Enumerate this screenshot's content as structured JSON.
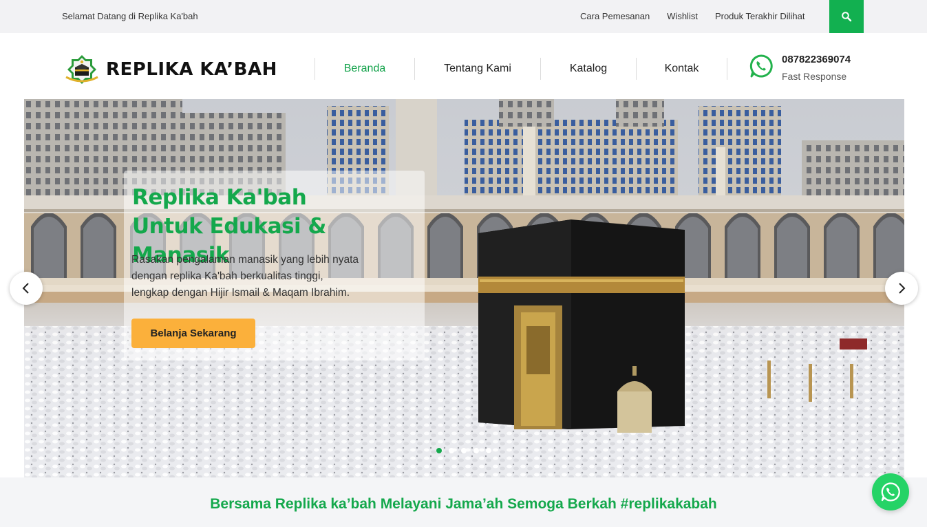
{
  "topbar": {
    "welcome": "Selamat Datang di Replika Ka'bah",
    "links": [
      "Cara Pemesanan",
      "Wishlist",
      "Produk Terakhir Dilihat"
    ],
    "search_icon": "search-icon"
  },
  "header": {
    "logo_text": "REPLIKA KA’BAH",
    "nav": [
      "Beranda",
      "Tentang Kami",
      "Katalog",
      "Kontak"
    ],
    "active_nav": "Beranda",
    "phone": "087822369074",
    "phone_note": "Fast Response",
    "phone_icon": "whatsapp-icon"
  },
  "hero": {
    "headline_1": "Replika Ka'bah",
    "headline_2": "Untuk Edukasi & Manasik",
    "desc_1": "Rasakan pengalaman manasik yang lebih nyata",
    "desc_2": "dengan replika Ka'bah berkualitas tinggi,",
    "desc_3": "lengkap dengan Hijir Ismail & Maqam Ibrahim.",
    "cta": "Belanja Sekarang",
    "slides": 5,
    "active_slide": 1
  },
  "tagline": "Bersama Replika ka’bah Melayani Jama’ah Semoga Berkah #replikakabah",
  "colors": {
    "brand_green": "#14a84c",
    "cta_orange": "#fbb03b",
    "whatsapp": "#25d366",
    "topbar_bg": "#f2f2f4"
  }
}
